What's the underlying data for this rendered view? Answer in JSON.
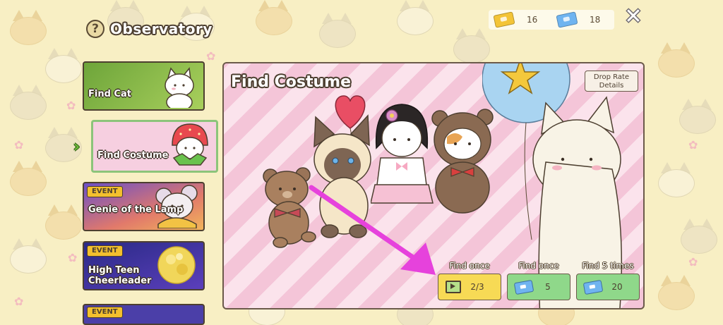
{
  "header": {
    "help_icon": "?",
    "title": "Observatory",
    "close_icon": "✕"
  },
  "currency": {
    "gold_tickets": "16",
    "blue_tickets": "18"
  },
  "sidebar": {
    "items": [
      {
        "label": "Find Cat",
        "badge": ""
      },
      {
        "label": "Find Costume",
        "badge": "",
        "selected": true
      },
      {
        "label": "Genie of the Lamp",
        "badge": "EVENT"
      },
      {
        "label": "High Teen Cheerleader",
        "badge": "EVENT"
      }
    ],
    "selector_icon": "›"
  },
  "panel": {
    "title": "Find Costume",
    "drop_rate_label": "Drop Rate Details"
  },
  "actions": [
    {
      "label": "Find once",
      "value": "2/3",
      "icon": "tv-ad-icon",
      "color": "#f7da55"
    },
    {
      "label": "Find once",
      "value": "5",
      "icon": "blue-ticket-icon",
      "color": "#8fd88a"
    },
    {
      "label": "Find 5 times",
      "value": "20",
      "icon": "blue-ticket-icon",
      "color": "#8fd88a"
    }
  ],
  "colors": {
    "background": "#f8efc4",
    "panel_stripe_a": "#f4c5d8",
    "panel_stripe_b": "#fbe3ec",
    "annotation_arrow": "#e642dc"
  }
}
